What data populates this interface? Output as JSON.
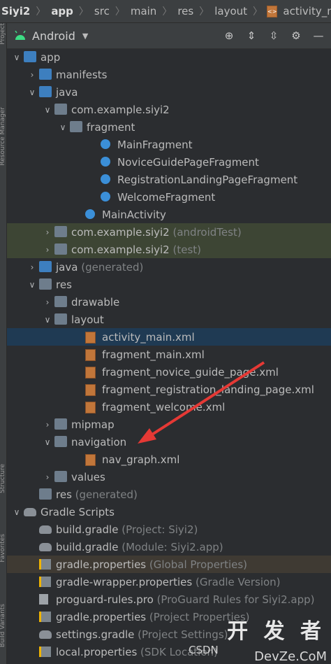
{
  "breadcrumb": {
    "items": [
      "Siyi2",
      "app",
      "src",
      "main",
      "res",
      "layout",
      "activity_main.xml"
    ]
  },
  "left_strip": {
    "tabs": [
      "Project",
      "Resource Manager",
      "Structure",
      "Favorites",
      "Build Variants"
    ]
  },
  "toolbar": {
    "view_label": "Android",
    "icons": [
      "locate-icon",
      "expand-all-icon",
      "collapse-all-icon",
      "settings-gear-icon",
      "hide-panel-icon"
    ]
  },
  "tree": [
    {
      "label": "app",
      "sub": "",
      "depth": 0,
      "arrow": "down",
      "icon": "module-folder",
      "hl": ""
    },
    {
      "label": "manifests",
      "sub": "",
      "depth": 1,
      "arrow": "right",
      "icon": "folder-blue",
      "hl": ""
    },
    {
      "label": "java",
      "sub": "",
      "depth": 1,
      "arrow": "down",
      "icon": "folder-blue",
      "hl": ""
    },
    {
      "label": "com.example.siyi2",
      "sub": "",
      "depth": 2,
      "arrow": "down",
      "icon": "package",
      "hl": ""
    },
    {
      "label": "fragment",
      "sub": "",
      "depth": 3,
      "arrow": "down",
      "icon": "package",
      "hl": ""
    },
    {
      "label": "MainFragment",
      "sub": "",
      "depth": 5,
      "arrow": "",
      "icon": "class",
      "hl": ""
    },
    {
      "label": "NoviceGuidePageFragment",
      "sub": "",
      "depth": 5,
      "arrow": "",
      "icon": "class",
      "hl": ""
    },
    {
      "label": "RegistrationLandingPageFragment",
      "sub": "",
      "depth": 5,
      "arrow": "",
      "icon": "class",
      "hl": ""
    },
    {
      "label": "WelcomeFragment",
      "sub": "",
      "depth": 5,
      "arrow": "",
      "icon": "class",
      "hl": ""
    },
    {
      "label": "MainActivity",
      "sub": "",
      "depth": 4,
      "arrow": "",
      "icon": "class",
      "hl": ""
    },
    {
      "label": "com.example.siyi2",
      "sub": "(androidTest)",
      "depth": 2,
      "arrow": "right",
      "icon": "package",
      "hl": "green"
    },
    {
      "label": "com.example.siyi2",
      "sub": "(test)",
      "depth": 2,
      "arrow": "right",
      "icon": "package",
      "hl": "green"
    },
    {
      "label": "java",
      "sub": "(generated)",
      "depth": 1,
      "arrow": "right",
      "icon": "folder-gen",
      "hl": ""
    },
    {
      "label": "res",
      "sub": "",
      "depth": 1,
      "arrow": "down",
      "icon": "folder-res",
      "hl": ""
    },
    {
      "label": "drawable",
      "sub": "",
      "depth": 2,
      "arrow": "right",
      "icon": "package",
      "hl": ""
    },
    {
      "label": "layout",
      "sub": "",
      "depth": 2,
      "arrow": "down",
      "icon": "package",
      "hl": ""
    },
    {
      "label": "activity_main.xml",
      "sub": "",
      "depth": 4,
      "arrow": "",
      "icon": "xml",
      "hl": "blue"
    },
    {
      "label": "fragment_main.xml",
      "sub": "",
      "depth": 4,
      "arrow": "",
      "icon": "xml",
      "hl": ""
    },
    {
      "label": "fragment_novice_guide_page.xml",
      "sub": "",
      "depth": 4,
      "arrow": "",
      "icon": "xml",
      "hl": ""
    },
    {
      "label": "fragment_registration_landing_page.xml",
      "sub": "",
      "depth": 4,
      "arrow": "",
      "icon": "xml",
      "hl": ""
    },
    {
      "label": "fragment_welcome.xml",
      "sub": "",
      "depth": 4,
      "arrow": "",
      "icon": "xml",
      "hl": ""
    },
    {
      "label": "mipmap",
      "sub": "",
      "depth": 2,
      "arrow": "right",
      "icon": "package",
      "hl": ""
    },
    {
      "label": "navigation",
      "sub": "",
      "depth": 2,
      "arrow": "down",
      "icon": "package",
      "hl": ""
    },
    {
      "label": "nav_graph.xml",
      "sub": "",
      "depth": 4,
      "arrow": "",
      "icon": "xml",
      "hl": ""
    },
    {
      "label": "values",
      "sub": "",
      "depth": 2,
      "arrow": "right",
      "icon": "package",
      "hl": ""
    },
    {
      "label": "res",
      "sub": "(generated)",
      "depth": 1,
      "arrow": "",
      "icon": "folder-res",
      "hl": ""
    },
    {
      "label": "Gradle Scripts",
      "sub": "",
      "depth": 0,
      "arrow": "down",
      "icon": "gradle",
      "hl": ""
    },
    {
      "label": "build.gradle",
      "sub": "(Project: Siyi2)",
      "depth": 1,
      "arrow": "",
      "icon": "gradle",
      "hl": ""
    },
    {
      "label": "build.gradle",
      "sub": "(Module: Siyi2.app)",
      "depth": 1,
      "arrow": "",
      "icon": "gradle",
      "hl": ""
    },
    {
      "label": "gradle.properties",
      "sub": "(Global Properties)",
      "depth": 1,
      "arrow": "",
      "icon": "props",
      "hl": "brown"
    },
    {
      "label": "gradle-wrapper.properties",
      "sub": "(Gradle Version)",
      "depth": 1,
      "arrow": "",
      "icon": "props",
      "hl": ""
    },
    {
      "label": "proguard-rules.pro",
      "sub": "(ProGuard Rules for Siyi2.app)",
      "depth": 1,
      "arrow": "",
      "icon": "txt",
      "hl": ""
    },
    {
      "label": "gradle.properties",
      "sub": "(Project Properties)",
      "depth": 1,
      "arrow": "",
      "icon": "props",
      "hl": ""
    },
    {
      "label": "settings.gradle",
      "sub": "(Project Settings)",
      "depth": 1,
      "arrow": "",
      "icon": "gradle",
      "hl": ""
    },
    {
      "label": "local.properties",
      "sub": "(SDK Location)",
      "depth": 1,
      "arrow": "",
      "icon": "props",
      "hl": ""
    }
  ],
  "watermark": {
    "text": "开 发 者",
    "sub": "DevZe.CoM",
    "csdn": "CSDN"
  },
  "colors": {
    "arrow_annotation": "#e53935",
    "selection": "#1f3a53",
    "test_highlight": "#3d4534"
  }
}
